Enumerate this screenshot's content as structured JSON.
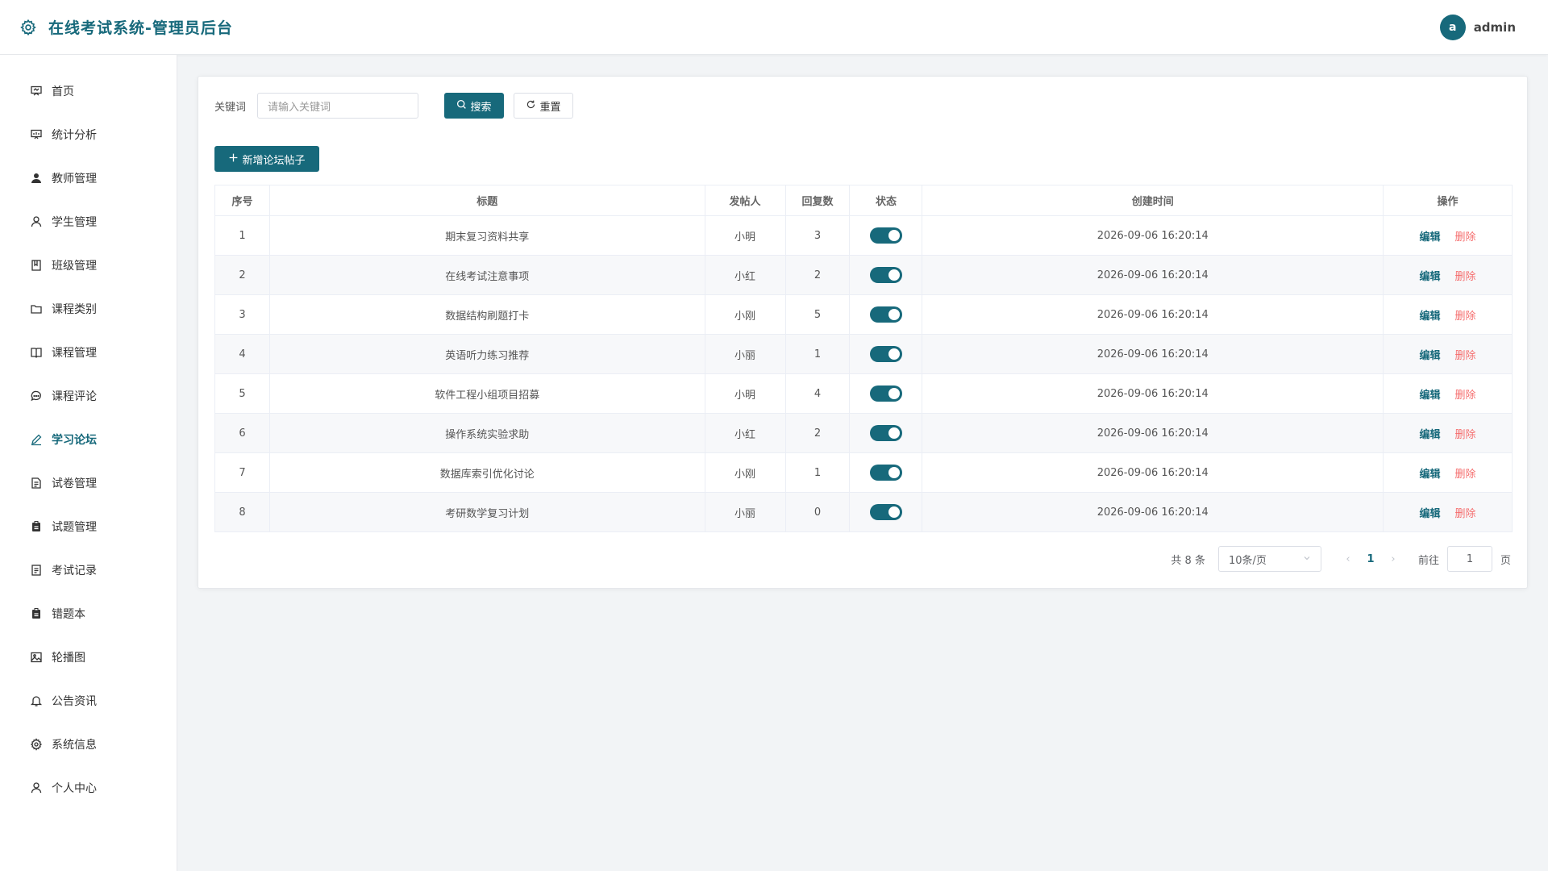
{
  "header": {
    "title": "在线考试系统-管理员后台",
    "avatar_letter": "a",
    "username": "admin"
  },
  "sidebar": {
    "items": [
      {
        "label": "首页",
        "icon": "presentation-icon"
      },
      {
        "label": "统计分析",
        "icon": "chart-board-icon"
      },
      {
        "label": "教师管理",
        "icon": "user-filled-icon"
      },
      {
        "label": "学生管理",
        "icon": "user-icon"
      },
      {
        "label": "班级管理",
        "icon": "notebook-icon"
      },
      {
        "label": "课程类别",
        "icon": "folder-icon"
      },
      {
        "label": "课程管理",
        "icon": "book-icon"
      },
      {
        "label": "课程评论",
        "icon": "chat-icon"
      },
      {
        "label": "学习论坛",
        "icon": "edit-pen-icon",
        "active": true
      },
      {
        "label": "试卷管理",
        "icon": "document-icon"
      },
      {
        "label": "试题管理",
        "icon": "clipboard-icon"
      },
      {
        "label": "考试记录",
        "icon": "tickets-icon"
      },
      {
        "label": "错题本",
        "icon": "clipboard-filled-icon"
      },
      {
        "label": "轮播图",
        "icon": "picture-icon"
      },
      {
        "label": "公告资讯",
        "icon": "bell-icon"
      },
      {
        "label": "系统信息",
        "icon": "gear-icon"
      },
      {
        "label": "个人中心",
        "icon": "user-icon"
      }
    ]
  },
  "search": {
    "label": "关键词",
    "placeholder": "请输入关键词",
    "search_button": "搜索",
    "reset_button": "重置"
  },
  "add_button": "新增论坛帖子",
  "table": {
    "headers": [
      "序号",
      "标题",
      "发帖人",
      "回复数",
      "状态",
      "创建时间",
      "操作"
    ],
    "rows": [
      {
        "no": "1",
        "title": "期末复习资料共享",
        "author": "小明",
        "replies": "3",
        "status": true,
        "created": "2026-09-06 16:20:14"
      },
      {
        "no": "2",
        "title": "在线考试注意事项",
        "author": "小红",
        "replies": "2",
        "status": true,
        "created": "2026-09-06 16:20:14"
      },
      {
        "no": "3",
        "title": "数据结构刷题打卡",
        "author": "小刚",
        "replies": "5",
        "status": true,
        "created": "2026-09-06 16:20:14"
      },
      {
        "no": "4",
        "title": "英语听力练习推荐",
        "author": "小丽",
        "replies": "1",
        "status": true,
        "created": "2026-09-06 16:20:14"
      },
      {
        "no": "5",
        "title": "软件工程小组项目招募",
        "author": "小明",
        "replies": "4",
        "status": true,
        "created": "2026-09-06 16:20:14"
      },
      {
        "no": "6",
        "title": "操作系统实验求助",
        "author": "小红",
        "replies": "2",
        "status": true,
        "created": "2026-09-06 16:20:14"
      },
      {
        "no": "7",
        "title": "数据库索引优化讨论",
        "author": "小刚",
        "replies": "1",
        "status": true,
        "created": "2026-09-06 16:20:14"
      },
      {
        "no": "8",
        "title": "考研数学复习计划",
        "author": "小丽",
        "replies": "0",
        "status": true,
        "created": "2026-09-06 16:20:14"
      }
    ],
    "edit_label": "编辑",
    "delete_label": "删除"
  },
  "pagination": {
    "total_text": "共 8 条",
    "page_size": "10条/页",
    "current_page": "1",
    "goto_label": "前往",
    "goto_value": "1",
    "page_suffix": "页"
  },
  "colors": {
    "accent": "#17697b",
    "danger": "#f56c6c"
  }
}
